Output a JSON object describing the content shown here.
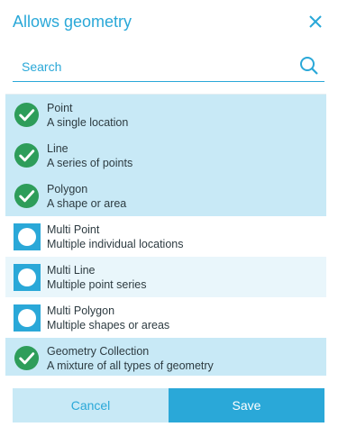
{
  "dialog": {
    "title": "Allows geometry"
  },
  "search": {
    "placeholder": "Search",
    "value": ""
  },
  "items": [
    {
      "label": "Point",
      "description": "A single location",
      "selected": true
    },
    {
      "label": "Line",
      "description": "A series of points",
      "selected": true
    },
    {
      "label": "Polygon",
      "description": "A shape or area",
      "selected": true
    },
    {
      "label": "Multi Point",
      "description": "Multiple individual locations",
      "selected": false
    },
    {
      "label": "Multi Line",
      "description": "Multiple point series",
      "selected": false
    },
    {
      "label": "Multi Polygon",
      "description": "Multiple shapes or areas",
      "selected": false
    },
    {
      "label": "Geometry Collection",
      "description": "A mixture of all types of geometry",
      "selected": true
    }
  ],
  "footer": {
    "cancel_label": "Cancel",
    "save_label": "Save"
  },
  "colors": {
    "accent": "#2aa8d8",
    "selected_row": "#c8e9f6",
    "check_green": "#2e9d5a"
  },
  "icons": {
    "close": "close-icon",
    "search": "search-icon",
    "selected": "check-circle-icon",
    "unselected": "empty-checkbox-icon"
  }
}
